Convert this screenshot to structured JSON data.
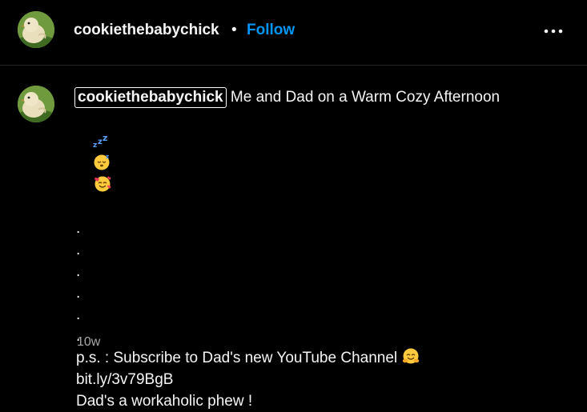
{
  "header": {
    "username": "cookiethebabychick",
    "separator": "•",
    "follow_label": "Follow",
    "more_icon": "more-horizontal-icon"
  },
  "caption": {
    "username": "cookiethebabychick",
    "title": " Me and Dad on a Warm Cozy Afternoon",
    "emojis": [
      "zzz-emoji",
      "sleeping-face-emoji",
      "smiling-face-with-hearts-emoji"
    ],
    "dots": [
      ".",
      ".",
      ".",
      ".",
      ".",
      "."
    ],
    "ps_line": "p.s. : Subscribe to Dad's new YouTube Channel ",
    "ps_emoji": "hugging-face-emoji",
    "link": "bit.ly/3v79BgB",
    "closing": "Dad's a workaholic phew !",
    "timestamp": "10w"
  },
  "colors": {
    "background": "#000000",
    "text": "#f5f5f5",
    "follow": "#0095f6",
    "muted": "#a8a8a8",
    "divider": "#262626"
  }
}
